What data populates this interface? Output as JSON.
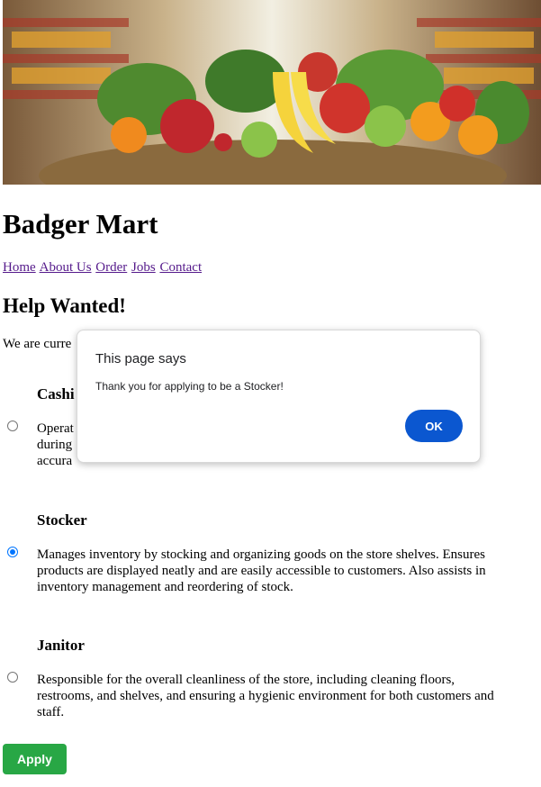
{
  "banner": {
    "alt_icon": "grocery-produce-banner"
  },
  "site": {
    "title": "Badger Mart"
  },
  "nav": {
    "items": [
      "Home",
      "About Us",
      "Order",
      "Jobs",
      "Contact"
    ]
  },
  "main": {
    "heading": "Help Wanted!",
    "intro": "We are curre"
  },
  "jobs": [
    {
      "title": "Cashi",
      "description": "Operat\nduring\naccura",
      "selected": false
    },
    {
      "title": "Stocker",
      "description": "Manages inventory by stocking and organizing goods on the store shelves. Ensures products are displayed neatly and are easily accessible to customers. Also assists in inventory management and reordering of stock.",
      "selected": true
    },
    {
      "title": "Janitor",
      "description": "Responsible for the overall cleanliness of the store, including cleaning floors, restrooms, and shelves, and ensuring a hygienic environment for both customers and staff.",
      "selected": false
    }
  ],
  "form": {
    "apply_label": "Apply",
    "apply_color": "#28a745"
  },
  "dialog": {
    "title": "This page says",
    "message": "Thank you for applying to be a Stocker!",
    "ok_label": "OK",
    "ok_color": "#0b57d0"
  }
}
